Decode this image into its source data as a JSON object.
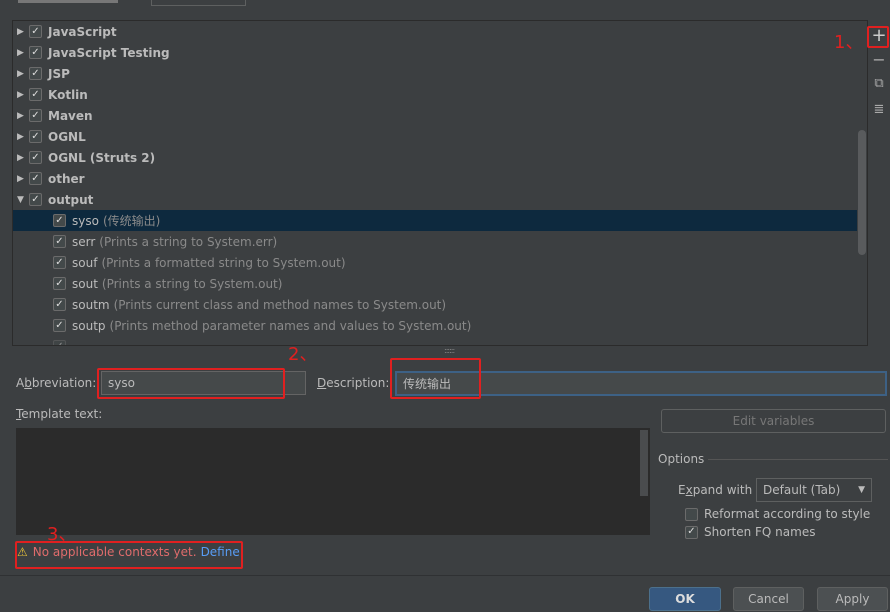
{
  "tree": {
    "groups": [
      {
        "label": "JavaScript",
        "checked": true,
        "expanded": false
      },
      {
        "label": "JavaScript Testing",
        "checked": true,
        "expanded": false
      },
      {
        "label": "JSP",
        "checked": true,
        "expanded": false
      },
      {
        "label": "Kotlin",
        "checked": true,
        "expanded": false
      },
      {
        "label": "Maven",
        "checked": true,
        "expanded": false
      },
      {
        "label": "OGNL",
        "checked": true,
        "expanded": false
      },
      {
        "label": "OGNL (Struts 2)",
        "checked": true,
        "expanded": false
      },
      {
        "label": "other",
        "checked": true,
        "expanded": false
      },
      {
        "label": "output",
        "checked": true,
        "expanded": true
      }
    ],
    "items": [
      {
        "abbr": "syso",
        "desc": "(传统输出)",
        "selected": true
      },
      {
        "abbr": "serr",
        "desc": "(Prints a string to System.err)"
      },
      {
        "abbr": "souf",
        "desc": "(Prints a formatted string to System.out)"
      },
      {
        "abbr": "sout",
        "desc": "(Prints a string to System.out)"
      },
      {
        "abbr": "soutm",
        "desc": "(Prints current class and method names to System.out)"
      },
      {
        "abbr": "soutp",
        "desc": "(Prints method parameter names and values to System.out)"
      }
    ]
  },
  "toolbar": {
    "add": "+",
    "remove": "−",
    "copy": "⧉",
    "edit": "≣"
  },
  "form": {
    "abbreviation_label": "Abbreviation:",
    "abbreviation_value": "syso",
    "description_label": "Description:",
    "description_value": "传统输出",
    "template_label": "Template text:",
    "template_value": "",
    "edit_variables": "Edit variables",
    "warning": "No applicable contexts yet.",
    "define_link": "Define"
  },
  "options": {
    "title": "Options",
    "expand_label": "Expand with",
    "expand_value": "Default (Tab)",
    "reformat_label": "Reformat according to style",
    "reformat_checked": false,
    "shorten_label": "Shorten FQ names",
    "shorten_checked": true
  },
  "buttons": {
    "ok": "OK",
    "cancel": "Cancel",
    "apply": "Apply"
  },
  "annotations": {
    "a1": "1、",
    "a2": "2、",
    "a3": "3、"
  },
  "colors": {
    "selection": "#0d293e",
    "accent": "#365880",
    "annotation": "#e02020",
    "link": "#589df6",
    "warning": "#e06c6c"
  }
}
